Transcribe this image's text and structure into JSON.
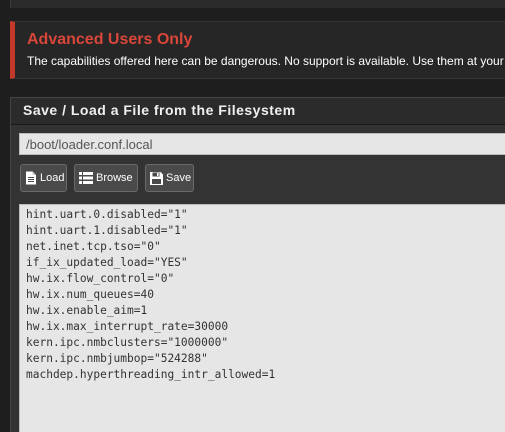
{
  "alert": {
    "title": "Advanced Users Only",
    "text": "The capabilities offered here can be dangerous. No support is available. Use them at your own risk!",
    "accent_color": "#d9463a"
  },
  "panel": {
    "title": "Save / Load a File from the Filesystem"
  },
  "file_path": {
    "value": "/boot/loader.conf.local"
  },
  "buttons": {
    "load": {
      "label": "Load",
      "icon": "file-icon"
    },
    "browse": {
      "label": "Browse",
      "icon": "list-icon"
    },
    "save": {
      "label": "Save",
      "icon": "floppy-disk-icon"
    }
  },
  "editor": {
    "lines": [
      "hint.uart.0.disabled=\"1\"",
      "hint.uart.1.disabled=\"1\"",
      "net.inet.tcp.tso=\"0\"",
      "if_ix_updated_load=\"YES\"",
      "hw.ix.flow_control=\"0\"",
      "hw.ix.num_queues=40",
      "hw.ix.enable_aim=1",
      "hw.ix.max_interrupt_rate=30000",
      "kern.ipc.nmbclusters=\"1000000\"",
      "kern.ipc.nmbjumbop=\"524288\"",
      "machdep.hyperthreading_intr_allowed=1"
    ]
  }
}
